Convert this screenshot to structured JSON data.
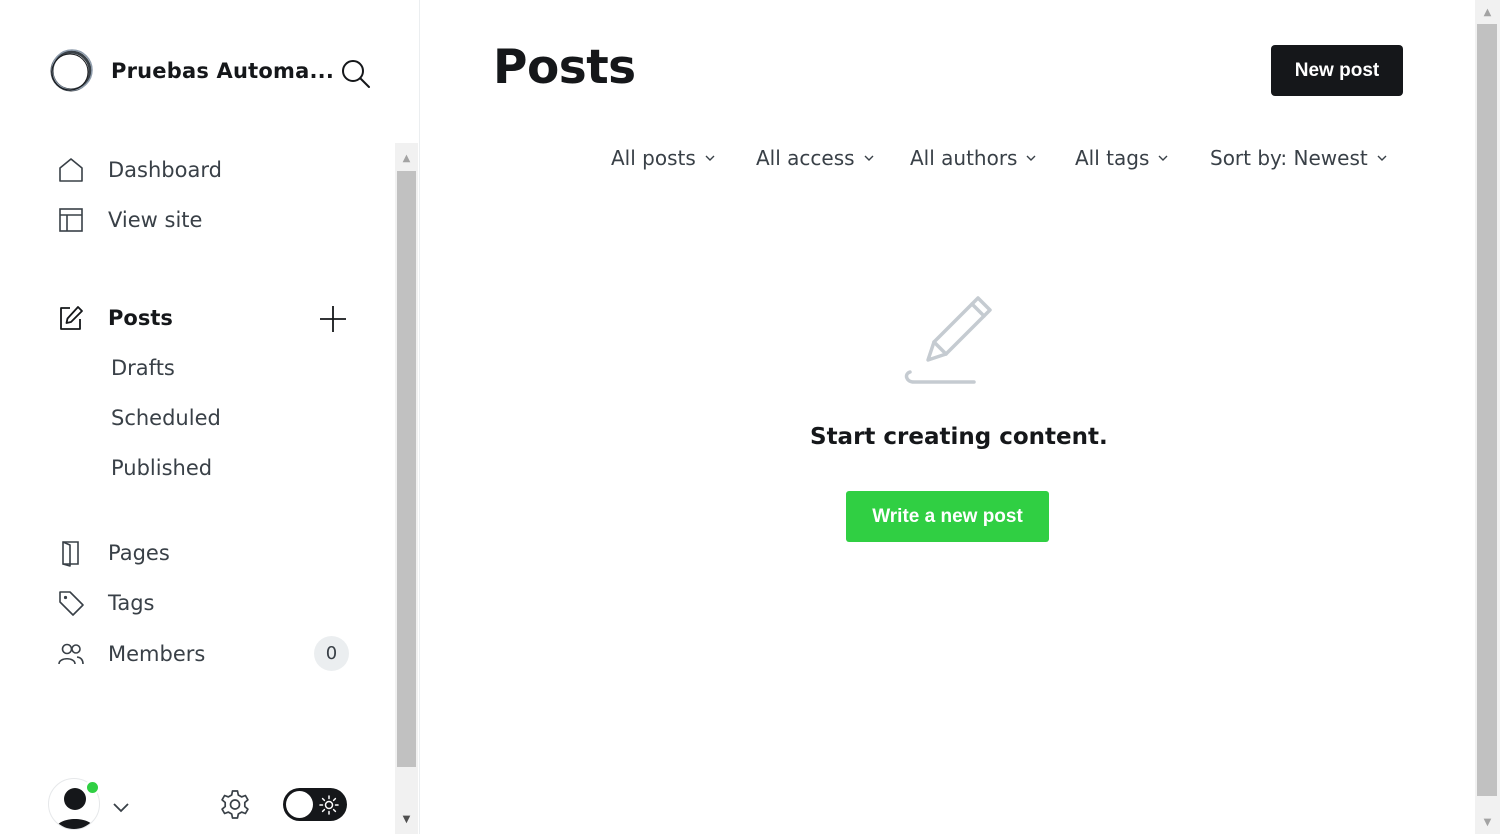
{
  "sidebar": {
    "site_title": "Pruebas Automa...",
    "nav": {
      "dashboard": "Dashboard",
      "view_site": "View site",
      "posts": "Posts",
      "drafts": "Drafts",
      "scheduled": "Scheduled",
      "published": "Published",
      "pages": "Pages",
      "tags": "Tags",
      "members": "Members",
      "members_count": "0"
    },
    "icons": [
      "site-logo-icon",
      "search-icon",
      "home-icon",
      "layout-icon",
      "edit-icon",
      "plus-icon",
      "page-icon",
      "tag-icon",
      "members-icon",
      "avatar-icon",
      "chevron-down-icon",
      "gear-icon",
      "sun-icon"
    ],
    "user_online_color": "#30cf43"
  },
  "header": {
    "title": "Posts",
    "new_post_label": "New post"
  },
  "filters": {
    "type": "All posts",
    "access": "All access",
    "authors": "All authors",
    "tags": "All tags",
    "sort": "Sort by: Newest"
  },
  "empty_state": {
    "message": "Start creating content.",
    "button_label": "Write a new post",
    "icon": "pencil-icon",
    "accent_color": "#30cf43"
  }
}
